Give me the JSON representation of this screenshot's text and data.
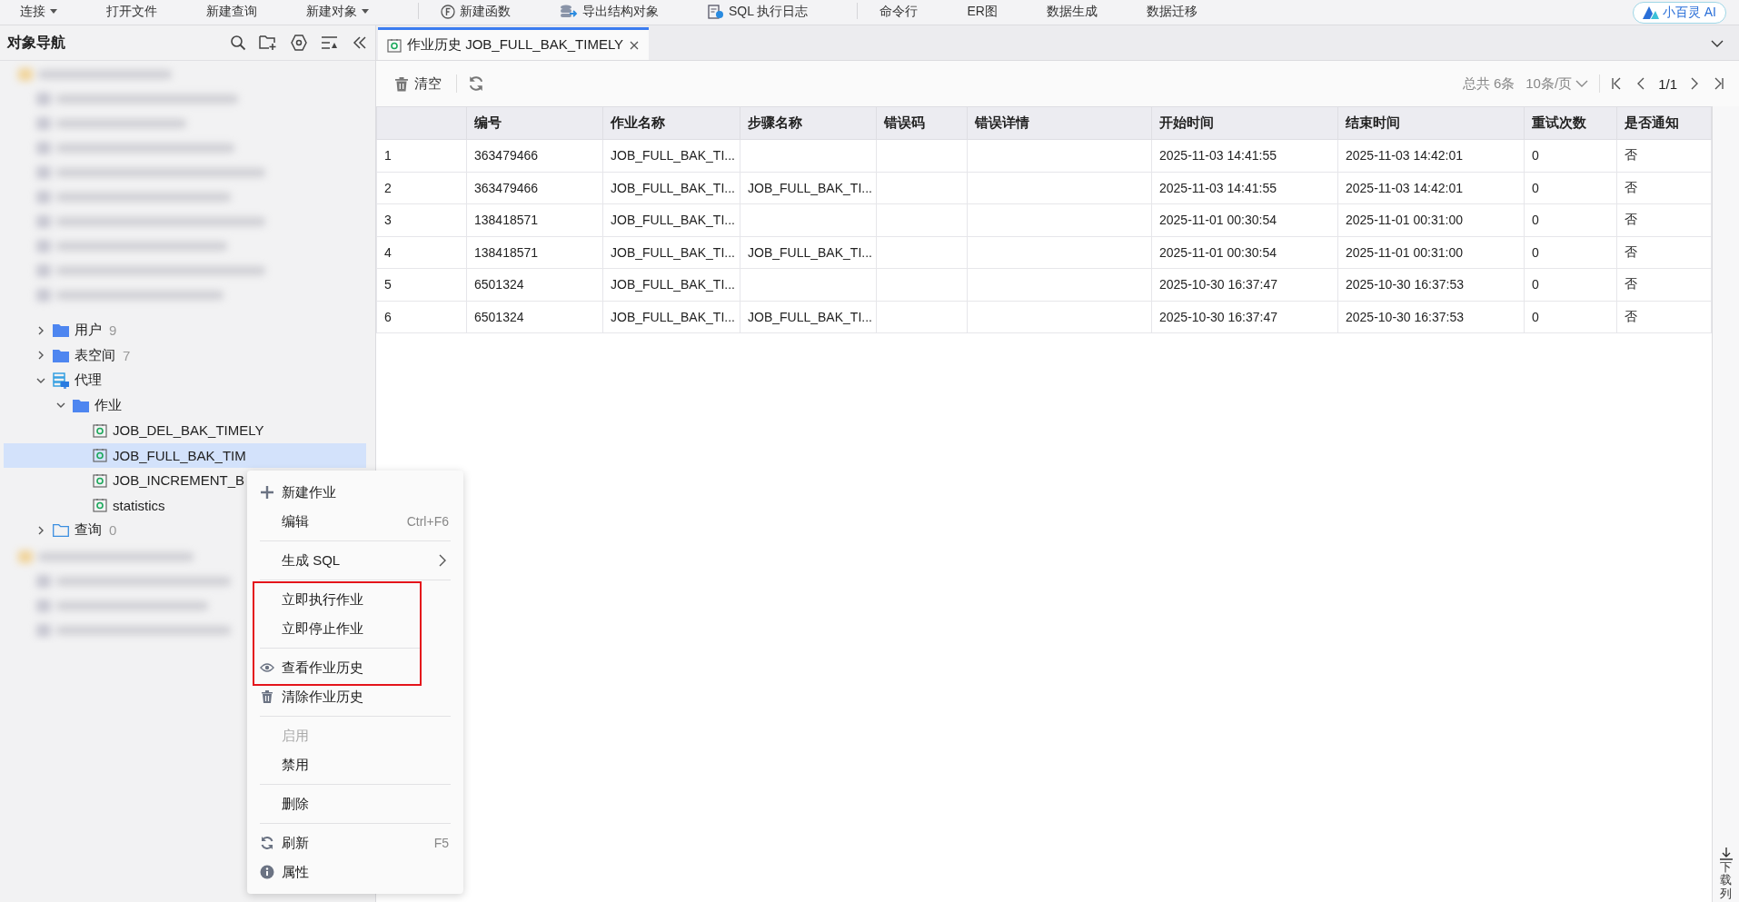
{
  "toolbar": {
    "items": [
      {
        "label": "连接",
        "kind": "text",
        "caret": true
      },
      {
        "label": "打开文件",
        "kind": "text",
        "caret": false
      },
      {
        "label": "新建查询",
        "kind": "text",
        "caret": false
      },
      {
        "label": "新建对象",
        "kind": "text",
        "caret": true
      },
      {
        "label": "新建函数",
        "kind": "function",
        "caret": false
      },
      {
        "label": "导出结构对象",
        "kind": "export",
        "caret": false
      },
      {
        "label": "SQL 执行日志",
        "kind": "log",
        "caret": false
      },
      {
        "label": "命令行",
        "kind": "text",
        "caret": false
      },
      {
        "label": "ER图",
        "kind": "text",
        "caret": false
      },
      {
        "label": "数据生成",
        "kind": "text",
        "caret": false
      },
      {
        "label": "数据迁移",
        "kind": "text",
        "caret": false
      }
    ],
    "ai_button": "小百灵 AI"
  },
  "navigator": {
    "title": "对象导航",
    "tree": [
      {
        "label": "用户",
        "count": "9",
        "kind": "folder",
        "expanded": false,
        "selected": false
      },
      {
        "label": "表空间",
        "count": "7",
        "kind": "folder",
        "expanded": false,
        "selected": false
      },
      {
        "label": "代理",
        "kind": "agent",
        "expanded": true,
        "selected": false,
        "children": [
          {
            "label": "作业",
            "kind": "folder",
            "expanded": true,
            "selected": false,
            "children": [
              {
                "label": "JOB_DEL_BAK_TIMELY",
                "kind": "job",
                "selected": false
              },
              {
                "label": "JOB_FULL_BAK_TIM",
                "kind": "job",
                "selected": true
              },
              {
                "label": "JOB_INCREMENT_B",
                "kind": "job",
                "selected": false
              },
              {
                "label": "statistics",
                "kind": "job",
                "selected": false
              }
            ]
          }
        ]
      },
      {
        "label": "查询",
        "count": "0",
        "kind": "query-folder",
        "expanded": false,
        "selected": false
      }
    ]
  },
  "tab": {
    "title": "作业历史 JOB_FULL_BAK_TIMELY",
    "selected": true
  },
  "history": {
    "clear_button": "清空",
    "total": "总共 6条",
    "page_size": "10条/页",
    "page": "1/1",
    "table": {
      "columns": [
        "",
        "编号",
        "作业名称",
        "步骤名称",
        "错误码",
        "错误详情",
        "开始时间",
        "结束时间",
        "重试次数",
        "是否通知"
      ],
      "rows": [
        [
          "1",
          "363479466",
          "JOB_FULL_BAK_TI...",
          "",
          "",
          "",
          "2025-11-03 14:41:55",
          "2025-11-03 14:42:01",
          "0",
          "否"
        ],
        [
          "2",
          "363479466",
          "JOB_FULL_BAK_TI...",
          "JOB_FULL_BAK_TI...",
          "",
          "",
          "2025-11-03 14:41:55",
          "2025-11-03 14:42:01",
          "0",
          "否"
        ],
        [
          "3",
          "138418571",
          "JOB_FULL_BAK_TI...",
          "",
          "",
          "",
          "2025-11-01 00:30:54",
          "2025-11-01 00:31:00",
          "0",
          "否"
        ],
        [
          "4",
          "138418571",
          "JOB_FULL_BAK_TI...",
          "JOB_FULL_BAK_TI...",
          "",
          "",
          "2025-11-01 00:30:54",
          "2025-11-01 00:31:00",
          "0",
          "否"
        ],
        [
          "5",
          "6501324",
          "JOB_FULL_BAK_TI...",
          "",
          "",
          "",
          "2025-10-30 16:37:47",
          "2025-10-30 16:37:53",
          "0",
          "否"
        ],
        [
          "6",
          "6501324",
          "JOB_FULL_BAK_TI...",
          "JOB_FULL_BAK_TI...",
          "",
          "",
          "2025-10-30 16:37:47",
          "2025-10-30 16:37:53",
          "0",
          "否"
        ]
      ]
    }
  },
  "side_strip": {
    "label": "下载列"
  },
  "context_menu": {
    "items": [
      {
        "kind": "item",
        "label": "新建作业",
        "disabled": false,
        "boxed": false
      },
      {
        "kind": "item",
        "label": "编辑",
        "shortcut": "Ctrl+F6",
        "disabled": false,
        "boxed": false
      },
      {
        "kind": "separator"
      },
      {
        "kind": "submenu",
        "label": "生成 SQL",
        "disabled": false,
        "boxed": false
      },
      {
        "kind": "separator"
      },
      {
        "kind": "item",
        "label": "立即执行作业",
        "disabled": false,
        "boxed": true
      },
      {
        "kind": "item",
        "label": "立即停止作业",
        "disabled": false,
        "boxed": true
      },
      {
        "kind": "separator"
      },
      {
        "kind": "item",
        "label": "查看作业历史",
        "disabled": false,
        "boxed": true
      },
      {
        "kind": "item",
        "label": "清除作业历史",
        "disabled": false,
        "boxed": false
      },
      {
        "kind": "separator"
      },
      {
        "kind": "item",
        "label": "启用",
        "disabled": true,
        "boxed": false
      },
      {
        "kind": "item",
        "label": "禁用",
        "disabled": false,
        "boxed": false
      },
      {
        "kind": "separator"
      },
      {
        "kind": "item",
        "label": "删除",
        "disabled": false,
        "boxed": false
      },
      {
        "kind": "separator"
      },
      {
        "kind": "item",
        "label": "刷新",
        "shortcut": "F5",
        "disabled": false,
        "boxed": false
      },
      {
        "kind": "item",
        "label": "属性",
        "disabled": false,
        "boxed": false
      }
    ]
  }
}
